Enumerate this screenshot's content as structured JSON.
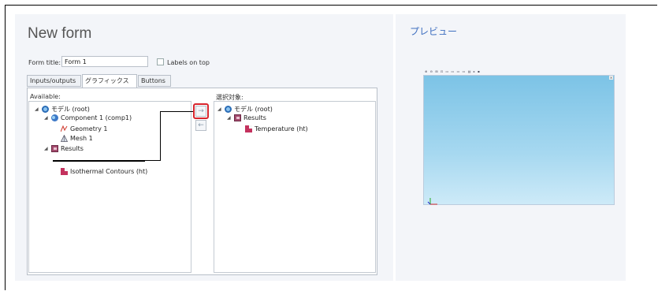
{
  "form": {
    "title": "New form",
    "form_title_label": "Form title:",
    "form_title_value": "Form 1",
    "labels_on_top": "Labels on top"
  },
  "tabs": [
    "Inputs/outputs",
    "グラフィックス",
    "Buttons"
  ],
  "available": {
    "label": "Available:",
    "items": [
      "モデル (root)",
      "Component 1 (comp1)",
      "Geometry 1",
      "Mesh 1",
      "Results",
      "Isothermal Contours (ht)"
    ]
  },
  "selected": {
    "label": "選択対象:",
    "items": [
      "モデル (root)",
      "Results",
      "Temperature (ht)"
    ]
  },
  "buttons": {
    "add_icon": "→",
    "remove_icon": "←"
  },
  "preview": {
    "title": "プレビュー",
    "toolbar_icons": "⊕ ⊖ ⊞ ⊡ ▭ ▭ ▭ ▭ ▤ ▸ ▪",
    "close_icon": "×"
  },
  "colors": {
    "highlight": "#d8262e",
    "accent_blue": "#3f6fc0",
    "canvas_top": "#7cc3e6"
  }
}
